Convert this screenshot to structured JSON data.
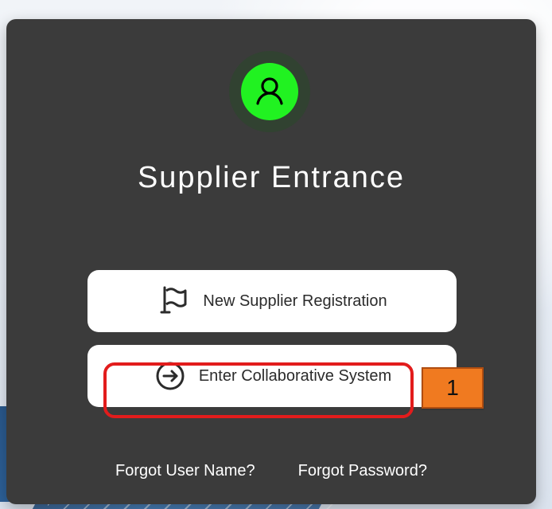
{
  "header": {
    "title": "Supplier Entrance",
    "avatar_icon": "user-icon"
  },
  "buttons": {
    "new_supplier_registration": {
      "label": "New Supplier Registration",
      "icon": "flag-icon"
    },
    "enter_collaborative_system": {
      "label": "Enter Collaborative System",
      "icon": "enter-arrow-icon"
    }
  },
  "links": {
    "forgot_user_name": "Forgot User Name?",
    "forgot_password": "Forgot Password?"
  },
  "annotation": {
    "step_number": "1"
  },
  "colors": {
    "card_bg": "#3b3b3b",
    "accent_green": "#21f221",
    "button_bg": "#ffffff",
    "highlight_red": "#e21c1c",
    "badge_orange": "#f07a20"
  }
}
